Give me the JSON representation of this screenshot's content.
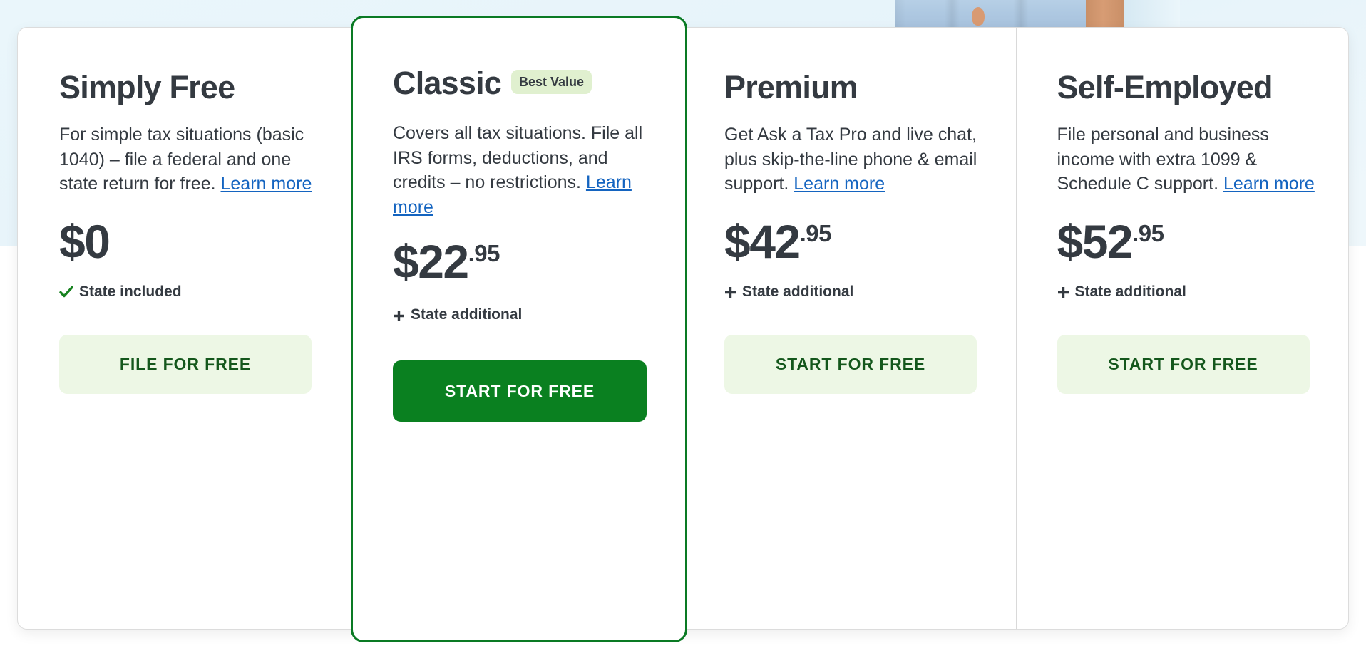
{
  "colors": {
    "brand_green": "#0a8020",
    "featured_border": "#0a7a24",
    "soft_green_bg": "#edf7e5",
    "soft_green_text": "#14571c",
    "badge_bg": "#e0f0cf",
    "link_blue": "#1464c0",
    "text_dark": "#343a41",
    "check_green": "#17821f",
    "panel_border": "#dcdcdc",
    "page_bg_top": "#eaf6fb"
  },
  "plans": [
    {
      "id": "simply-free",
      "title": "Simply Free",
      "badge": null,
      "description_text": "For simple tax situations (basic 1040) – file a federal and one state return for free. ",
      "description_link": "Learn more",
      "price_dollars": "$0",
      "price_cents": "",
      "state_icon": "check-icon",
      "state_note": "State included",
      "cta_label": "FILE FOR FREE",
      "cta_style": "soft",
      "featured": false
    },
    {
      "id": "classic",
      "title": "Classic",
      "badge": "Best Value",
      "description_text": "Covers all tax situations. File all IRS forms, deductions, and credits – no restrictions. ",
      "description_link": "Learn more",
      "price_dollars": "$22",
      "price_cents": ".95",
      "state_icon": "plus-icon",
      "state_note": "State additional",
      "cta_label": "START FOR FREE",
      "cta_style": "solid",
      "featured": true
    },
    {
      "id": "premium",
      "title": "Premium",
      "badge": null,
      "description_text": "Get Ask a Tax Pro and live chat, plus skip-the-line phone & email support. ",
      "description_link": "Learn more",
      "price_dollars": "$42",
      "price_cents": ".95",
      "state_icon": "plus-icon",
      "state_note": "State additional",
      "cta_label": "START FOR FREE",
      "cta_style": "soft",
      "featured": false
    },
    {
      "id": "self-employed",
      "title": "Self-Employed",
      "badge": null,
      "description_text": "File personal and business income with extra 1099 & Schedule C support. ",
      "description_link": "Learn more",
      "price_dollars": "$52",
      "price_cents": ".95",
      "state_icon": "plus-icon",
      "state_note": "State additional",
      "cta_label": "START FOR FREE",
      "cta_style": "soft",
      "featured": false
    }
  ],
  "hero": {
    "image_description": "person wearing light blue denim jeans"
  }
}
